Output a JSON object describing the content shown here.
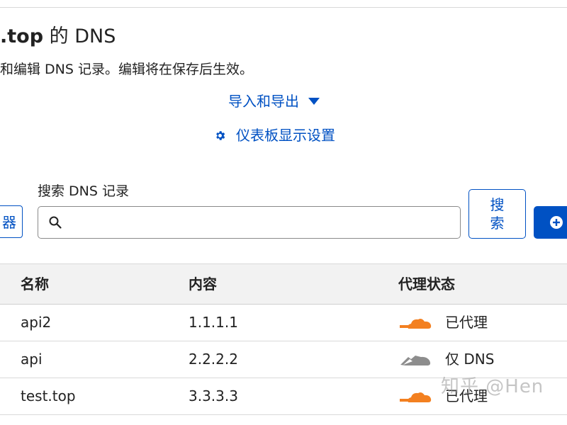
{
  "header": {
    "title_bold": ".top",
    "title_rest": " 的 DNS",
    "subtitle": "和编辑 DNS 记录。编辑将在保存后生效。"
  },
  "actions": {
    "import_export": "导入和导出",
    "dashboard_settings": "仪表板显示设置"
  },
  "filter": {
    "label": "器"
  },
  "search": {
    "label": "搜索 DNS 记录",
    "value": "",
    "placeholder": "",
    "button": "搜索"
  },
  "table": {
    "headers": [
      "名称",
      "内容",
      "代理状态"
    ],
    "rows": [
      {
        "name": "api2",
        "content": "1.1.1.1",
        "proxy": "已代理",
        "proxied": true
      },
      {
        "name": "api",
        "content": "2.2.2.2",
        "proxy": "仅 DNS",
        "proxied": false
      },
      {
        "name": "test.top",
        "content": "3.3.3.3",
        "proxy": "已代理",
        "proxied": true
      }
    ]
  },
  "watermark": "知乎 @Hen",
  "colors": {
    "link": "#0051c3",
    "proxied_cloud": "#f38020",
    "dns_only_cloud": "#8d8d8d"
  },
  "icons": [
    "caret-down-icon",
    "gear-icon",
    "search-icon",
    "plus-circle-icon",
    "cloud-icon"
  ]
}
